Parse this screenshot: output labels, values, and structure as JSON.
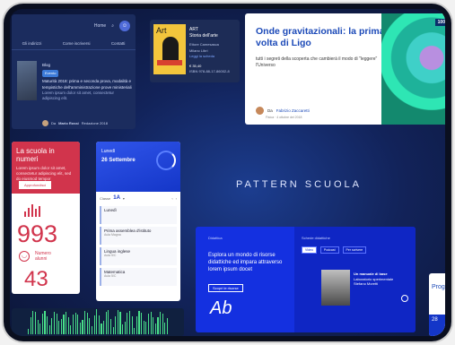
{
  "nav_card": {
    "links": [
      "Home"
    ],
    "menu": [
      "Gli indirizzi",
      "Come iscriversi",
      "Contatti"
    ],
    "tag1": "Blog",
    "tag2": "Evento",
    "article": "Maturità 2018: prima e seconda prova, modalità e tempistiche dell'amministrazione prove ministeriali",
    "desc": "Lorem ipsum dolor sit amet, consectetur adipiscing elit.",
    "author_prefix": "Da",
    "author": "Mario Rossi",
    "author_role": "Redazione 2018"
  },
  "book_card": {
    "cover_title": "Art",
    "label": "ART",
    "title": "Storia dell'arte",
    "meta": "Ettore Camesasca",
    "meta2": "Milano Libri",
    "price": "€ 35,40",
    "isbn": "ISBN 978-88-17-86002-8",
    "link": "Leggi la scheda"
  },
  "gravity_card": {
    "title": "Onde gravitazionali: la prima volta di Ligo",
    "desc": "tutti i segreti della scoperta che cambierà il modo di \"leggere\" l'Universo",
    "author_prefix": "Da",
    "author": "Fabrizio Zaccaretti",
    "date": "Fisica · 4 ottobre del 2018",
    "tag": "100"
  },
  "numbers_card": {
    "title": "La scuola in numeri",
    "text": "Lorem ipsum dolor sit amet, consectetur adipiscing elit, sed do eiusmod tempor",
    "button": "Approfondisci",
    "number1": "993",
    "label": "Numero alunni",
    "number2": "43"
  },
  "calendar_card": {
    "day": "Lunedì",
    "date": "26 Settembre",
    "class": "1A",
    "rows": [
      {
        "t": "Lunedì",
        "s": ""
      },
      {
        "t": "Prima assemblea d'istituto",
        "s": "Aula Magna"
      },
      {
        "t": "Lingua inglese",
        "s": "Aula 5/C"
      },
      {
        "t": "Matematica",
        "s": "Aula 5/C"
      }
    ]
  },
  "brand": "PATTERN SCUOLA",
  "blue_card": {
    "label": "Didattica",
    "headline": "Esplora un mondo di risorse didattiche ed impara attraverso lorem ipsum docet",
    "button": "Scopri le risorse",
    "iso": "Ab",
    "panel_title": "Schede didattiche",
    "tabs": [
      "Video",
      "Podcast",
      "Per scrivere"
    ],
    "tab_on": "Video",
    "person": "Un manuale di base",
    "person_sub": "Laboratorio sperimentale",
    "person_sub2": "Stefano Moretti"
  },
  "prog_card": {
    "title": "Prog",
    "box": "28"
  },
  "colors": {
    "accent": "#1436c8",
    "red": "#d1344c",
    "green": "#49e08a"
  }
}
